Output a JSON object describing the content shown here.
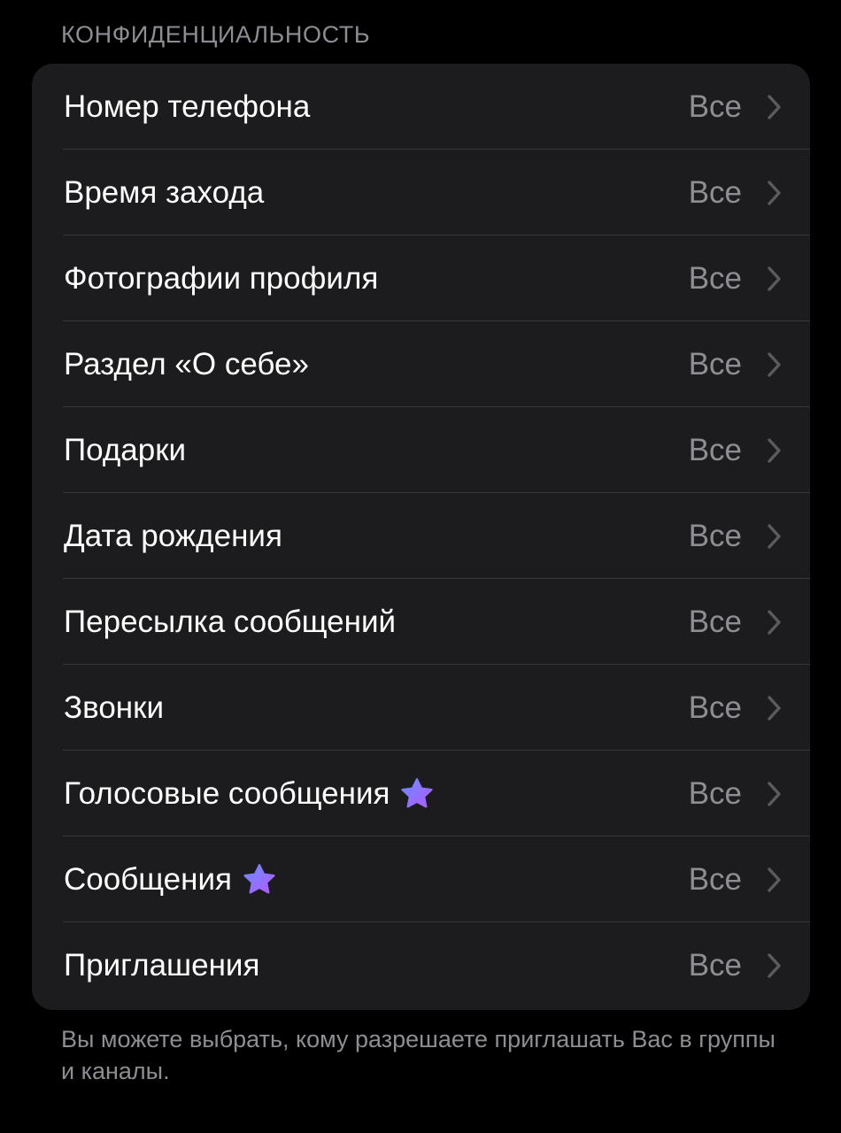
{
  "section": {
    "header": "КОНФИДЕНЦИАЛЬНОСТЬ",
    "footer": "Вы можете выбрать, кому разрешаете приглашать Вас в группы и каналы."
  },
  "rows": [
    {
      "label": "Номер телефона",
      "value": "Все",
      "premium_icon": false
    },
    {
      "label": "Время захода",
      "value": "Все",
      "premium_icon": false
    },
    {
      "label": "Фотографии профиля",
      "value": "Все",
      "premium_icon": false
    },
    {
      "label": "Раздел «О себе»",
      "value": "Все",
      "premium_icon": false
    },
    {
      "label": "Подарки",
      "value": "Все",
      "premium_icon": false
    },
    {
      "label": "Дата рождения",
      "value": "Все",
      "premium_icon": false
    },
    {
      "label": "Пересылка сообщений",
      "value": "Все",
      "premium_icon": false
    },
    {
      "label": "Звонки",
      "value": "Все",
      "premium_icon": false
    },
    {
      "label": "Голосовые сообщения",
      "value": "Все",
      "premium_icon": true
    },
    {
      "label": "Сообщения",
      "value": "Все",
      "premium_icon": true
    },
    {
      "label": "Приглашения",
      "value": "Все",
      "premium_icon": false
    }
  ],
  "icons": {
    "premium": "premium-star-icon",
    "chevron": "chevron-right-icon"
  },
  "colors": {
    "background": "#000000",
    "group_background": "#1c1c1e",
    "primary_text": "#ffffff",
    "secondary_text": "#8d8d93",
    "separator": "#38383a",
    "chevron": "#5a5a5f",
    "premium_gradient": [
      "#6b8cff",
      "#b05bff"
    ]
  }
}
